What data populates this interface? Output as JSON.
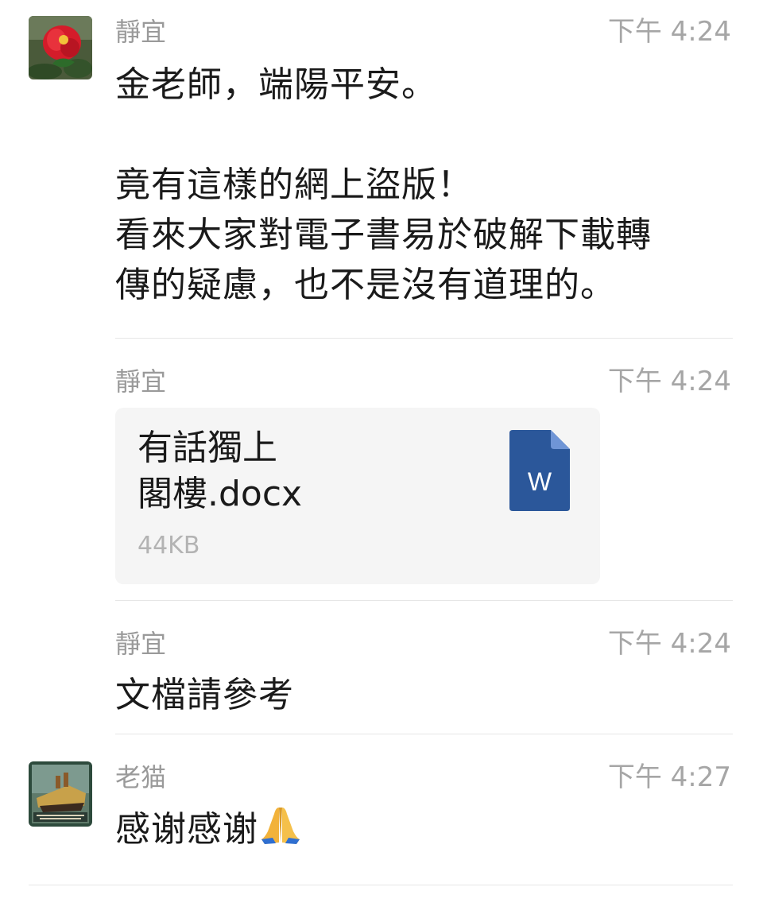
{
  "messages": [
    {
      "sender": "靜宜",
      "time": "下午 4:24",
      "lines": [
        "金老師，端陽平安。",
        "",
        "竟有這樣的網上盜版！",
        "看來大家對電子書易於破解下載轉",
        "傳的疑慮，也不是沒有道理的。"
      ]
    },
    {
      "sender": "靜宜",
      "time": "下午 4:24",
      "file": {
        "name_line1": "有話獨上",
        "name_line2": "閣樓.docx",
        "size": "44KB",
        "icon_letter": "W"
      }
    },
    {
      "sender": "靜宜",
      "time": "下午 4:24",
      "text": "文檔請參考"
    },
    {
      "sender": "老猫",
      "time": "下午 4:27",
      "text": "感谢感谢"
    }
  ],
  "colors": {
    "word_blue": "#2b579a",
    "meta_gray": "#a6a6a6",
    "text_dark": "#1a1a1a",
    "card_bg": "#f5f5f5"
  },
  "icons": {
    "avatar_1": "red-camellia-flower-avatar",
    "avatar_2": "ship-poster-avatar",
    "file": "word-document-icon",
    "emoji": "folded-hands-emoji"
  }
}
